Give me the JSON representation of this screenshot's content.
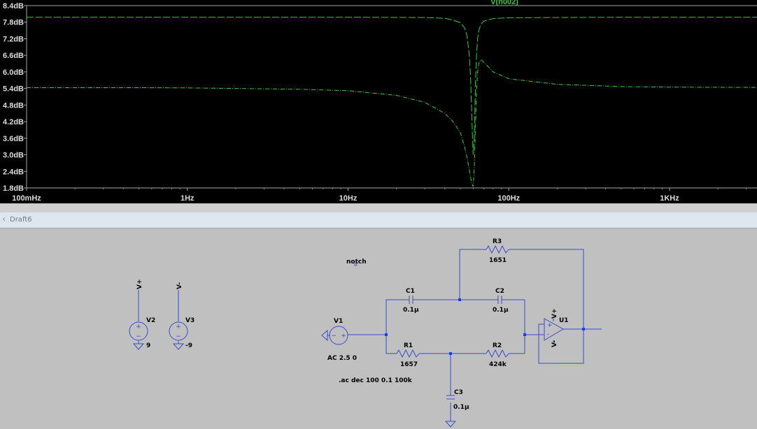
{
  "window": {
    "tab_title": "Draft6",
    "tab_icon": "schematic-icon"
  },
  "colors": {
    "plot_bg": "#000000",
    "trace": "#3dc93d",
    "schematic_bg": "#c0c0c0",
    "wire": "#3a4cc9"
  },
  "chart_data": {
    "type": "line",
    "title": "V(n002)",
    "x_scale": "log",
    "xlim": [
      0.1,
      3500
    ],
    "x_ticks": [
      "100mHz",
      "1Hz",
      "10Hz",
      "100Hz",
      "1KHz"
    ],
    "x_tick_values": [
      0.1,
      1,
      10,
      100,
      1000
    ],
    "ylim": [
      1.8,
      8.4
    ],
    "y_ticks": [
      "8.4dB",
      "7.8dB",
      "7.2dB",
      "6.6dB",
      "6.0dB",
      "5.4dB",
      "4.8dB",
      "4.2dB",
      "3.6dB",
      "3.0dB",
      "2.4dB",
      "1.8dB"
    ],
    "y_tick_values": [
      8.4,
      7.8,
      7.2,
      6.6,
      6.0,
      5.4,
      4.8,
      4.2,
      3.6,
      3.0,
      2.4,
      1.8
    ],
    "grid": false,
    "series": [
      {
        "x": [
          0.1,
          0.5,
          1,
          2,
          5,
          10,
          20,
          30,
          40,
          45,
          50,
          53,
          55,
          57,
          58,
          59,
          60,
          61,
          62,
          63,
          64,
          65,
          67,
          70,
          80,
          100,
          200,
          500,
          1000,
          3500
        ],
        "values": [
          5.43,
          5.43,
          5.42,
          5.4,
          5.37,
          5.32,
          5.15,
          4.9,
          4.5,
          4.2,
          3.8,
          3.3,
          2.9,
          2.4,
          2.15,
          1.95,
          1.85,
          2.5,
          4.0,
          5.3,
          6.0,
          6.3,
          6.45,
          6.35,
          6.0,
          5.75,
          5.55,
          5.47,
          5.45,
          5.44
        ]
      },
      {
        "x": [
          0.1,
          1,
          10,
          30,
          40,
          45,
          50,
          53,
          55,
          57,
          58,
          59,
          60,
          61,
          62,
          63,
          64,
          65,
          67,
          70,
          80,
          100,
          200,
          500,
          1000,
          3500
        ],
        "values": [
          7.98,
          7.98,
          7.98,
          7.97,
          7.94,
          7.88,
          7.78,
          7.6,
          7.3,
          6.5,
          5.6,
          4.2,
          3.0,
          3.6,
          5.6,
          6.6,
          7.2,
          7.5,
          7.72,
          7.84,
          7.93,
          7.96,
          7.97,
          7.98,
          7.98,
          7.98
        ]
      }
    ]
  },
  "schematic": {
    "directive_net": "notch",
    "directive_ac": ".ac dec 100 0.1 100k",
    "V1": {
      "name": "V1",
      "value": "AC 2.5 0"
    },
    "V2": {
      "name": "V2",
      "value": "9",
      "label": "V+"
    },
    "V3": {
      "name": "V3",
      "value": "-9",
      "label": "V-"
    },
    "R1": {
      "name": "R1",
      "value": "1657"
    },
    "R2": {
      "name": "R2",
      "value": "424k"
    },
    "R3": {
      "name": "R3",
      "value": "1651"
    },
    "C1": {
      "name": "C1",
      "value": "0.1µ"
    },
    "C2": {
      "name": "C2",
      "value": "0.1µ"
    },
    "C3": {
      "name": "C3",
      "value": "0.1µ"
    },
    "U1": {
      "name": "U1",
      "vplus": "V+",
      "vminus": "V-",
      "plus_sign": "+",
      "minus_sign": "-"
    },
    "src_plus": "+",
    "src_minus": "−"
  }
}
